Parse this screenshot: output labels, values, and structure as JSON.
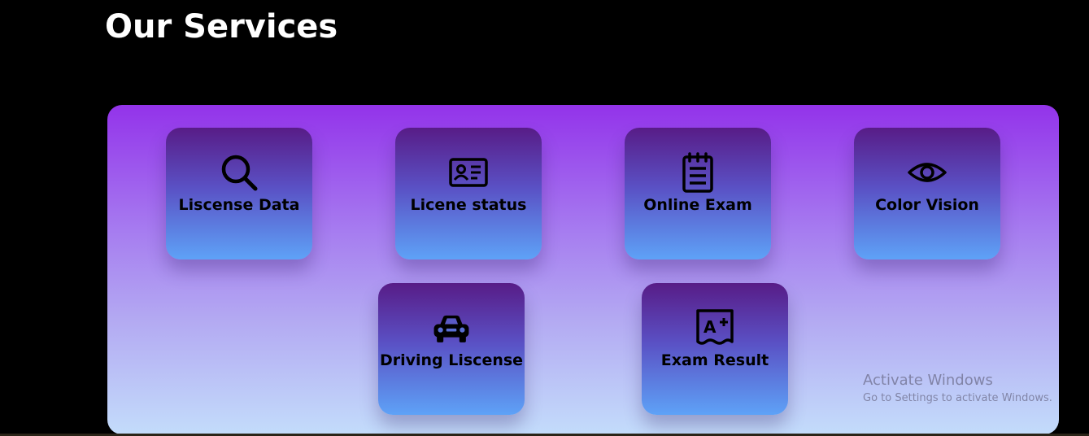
{
  "section": {
    "title": "Our Services"
  },
  "services": [
    {
      "label": "Liscense Data",
      "icon": "search-icon"
    },
    {
      "label": "Licene status",
      "icon": "id-card-icon"
    },
    {
      "label": "Online Exam",
      "icon": "notepad-icon"
    },
    {
      "label": "Color Vision",
      "icon": "eye-icon"
    },
    {
      "label": "Driving Liscense",
      "icon": "car-icon"
    },
    {
      "label": "Exam Result",
      "icon": "grade-a-plus-icon"
    }
  ],
  "watermark": {
    "line1": "Activate Windows",
    "line2": "Go to Settings to activate Windows."
  },
  "colors": {
    "page_background": "#000000",
    "panel_top": "#9333ea",
    "panel_bottom": "#c3dcfb",
    "card_top": "#581c87",
    "card_bottom": "#5ea2f7",
    "title_text": "#ffffff",
    "card_text": "#000000"
  }
}
